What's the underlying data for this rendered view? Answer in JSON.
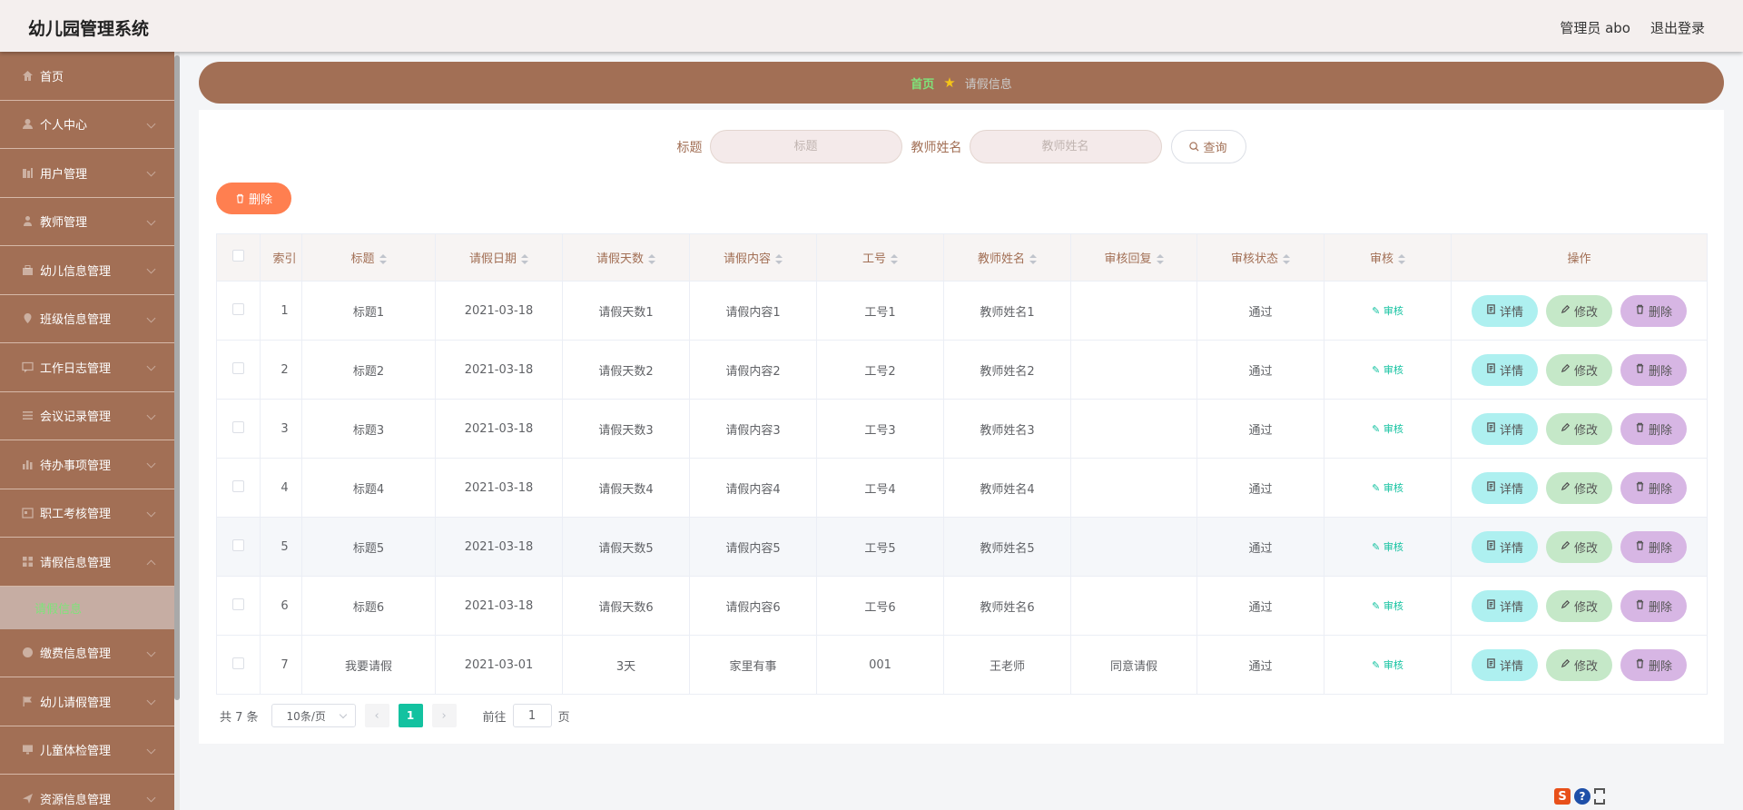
{
  "app": {
    "title": "幼儿园管理系统"
  },
  "header": {
    "user": "管理员 abo",
    "logout": "退出登录"
  },
  "sidebar": {
    "items": [
      {
        "label": "首页",
        "icon": "home-icon",
        "chevron": false
      },
      {
        "label": "个人中心",
        "icon": "person-icon",
        "chevron": true
      },
      {
        "label": "用户管理",
        "icon": "users-icon",
        "chevron": true
      },
      {
        "label": "教师管理",
        "icon": "teacher-icon",
        "chevron": true
      },
      {
        "label": "幼儿信息管理",
        "icon": "briefcase-icon",
        "chevron": true
      },
      {
        "label": "班级信息管理",
        "icon": "pin-icon",
        "chevron": true
      },
      {
        "label": "工作日志管理",
        "icon": "chat-icon",
        "chevron": true
      },
      {
        "label": "会议记录管理",
        "icon": "list-icon",
        "chevron": true
      },
      {
        "label": "待办事项管理",
        "icon": "bar-chart-icon",
        "chevron": true
      },
      {
        "label": "职工考核管理",
        "icon": "calendar-icon",
        "chevron": true
      },
      {
        "label": "请假信息管理",
        "icon": "grid-icon",
        "chevron": true,
        "expanded": true,
        "sub": "请假信息"
      },
      {
        "label": "缴费信息管理",
        "icon": "globe-icon",
        "chevron": true
      },
      {
        "label": "幼儿请假管理",
        "icon": "flag-icon",
        "chevron": true
      },
      {
        "label": "儿童体检管理",
        "icon": "monitor-icon",
        "chevron": true
      },
      {
        "label": "资源信息管理",
        "icon": "send-icon",
        "chevron": true
      }
    ]
  },
  "breadcrumb": {
    "home": "首页",
    "current": "请假信息"
  },
  "search": {
    "title_label": "标题",
    "title_placeholder": "标题",
    "teacher_label": "教师姓名",
    "teacher_placeholder": "教师姓名",
    "button": "查询"
  },
  "toolbar": {
    "delete_label": "删除"
  },
  "table": {
    "headers": [
      "索引",
      "标题",
      "请假日期",
      "请假天数",
      "请假内容",
      "工号",
      "教师姓名",
      "审核回复",
      "审核状态",
      "审核",
      "操作"
    ],
    "audit_link": "审核",
    "actions": {
      "detail": "详情",
      "edit": "修改",
      "delete": "删除"
    },
    "rows": [
      [
        "1",
        "标题1",
        "2021-03-18",
        "请假天数1",
        "请假内容1",
        "工号1",
        "教师姓名1",
        "",
        "通过"
      ],
      [
        "2",
        "标题2",
        "2021-03-18",
        "请假天数2",
        "请假内容2",
        "工号2",
        "教师姓名2",
        "",
        "通过"
      ],
      [
        "3",
        "标题3",
        "2021-03-18",
        "请假天数3",
        "请假内容3",
        "工号3",
        "教师姓名3",
        "",
        "通过"
      ],
      [
        "4",
        "标题4",
        "2021-03-18",
        "请假天数4",
        "请假内容4",
        "工号4",
        "教师姓名4",
        "",
        "通过"
      ],
      [
        "5",
        "标题5",
        "2021-03-18",
        "请假天数5",
        "请假内容5",
        "工号5",
        "教师姓名5",
        "",
        "通过"
      ],
      [
        "6",
        "标题6",
        "2021-03-18",
        "请假天数6",
        "请假内容6",
        "工号6",
        "教师姓名6",
        "",
        "通过"
      ],
      [
        "7",
        "我要请假",
        "2021-03-01",
        "3天",
        "家里有事",
        "001",
        "王老师",
        "同意请假",
        "通过"
      ]
    ],
    "highlight_row": 4
  },
  "pagination": {
    "total": "共 7 条",
    "page_size": "10条/页",
    "current_page": "1",
    "goto_prefix": "前往",
    "goto_value": "1",
    "goto_suffix": "页"
  },
  "colors": {
    "brand": "#a26f55",
    "accent_green": "#13c2a0",
    "delete_orange": "#ff7f50"
  }
}
